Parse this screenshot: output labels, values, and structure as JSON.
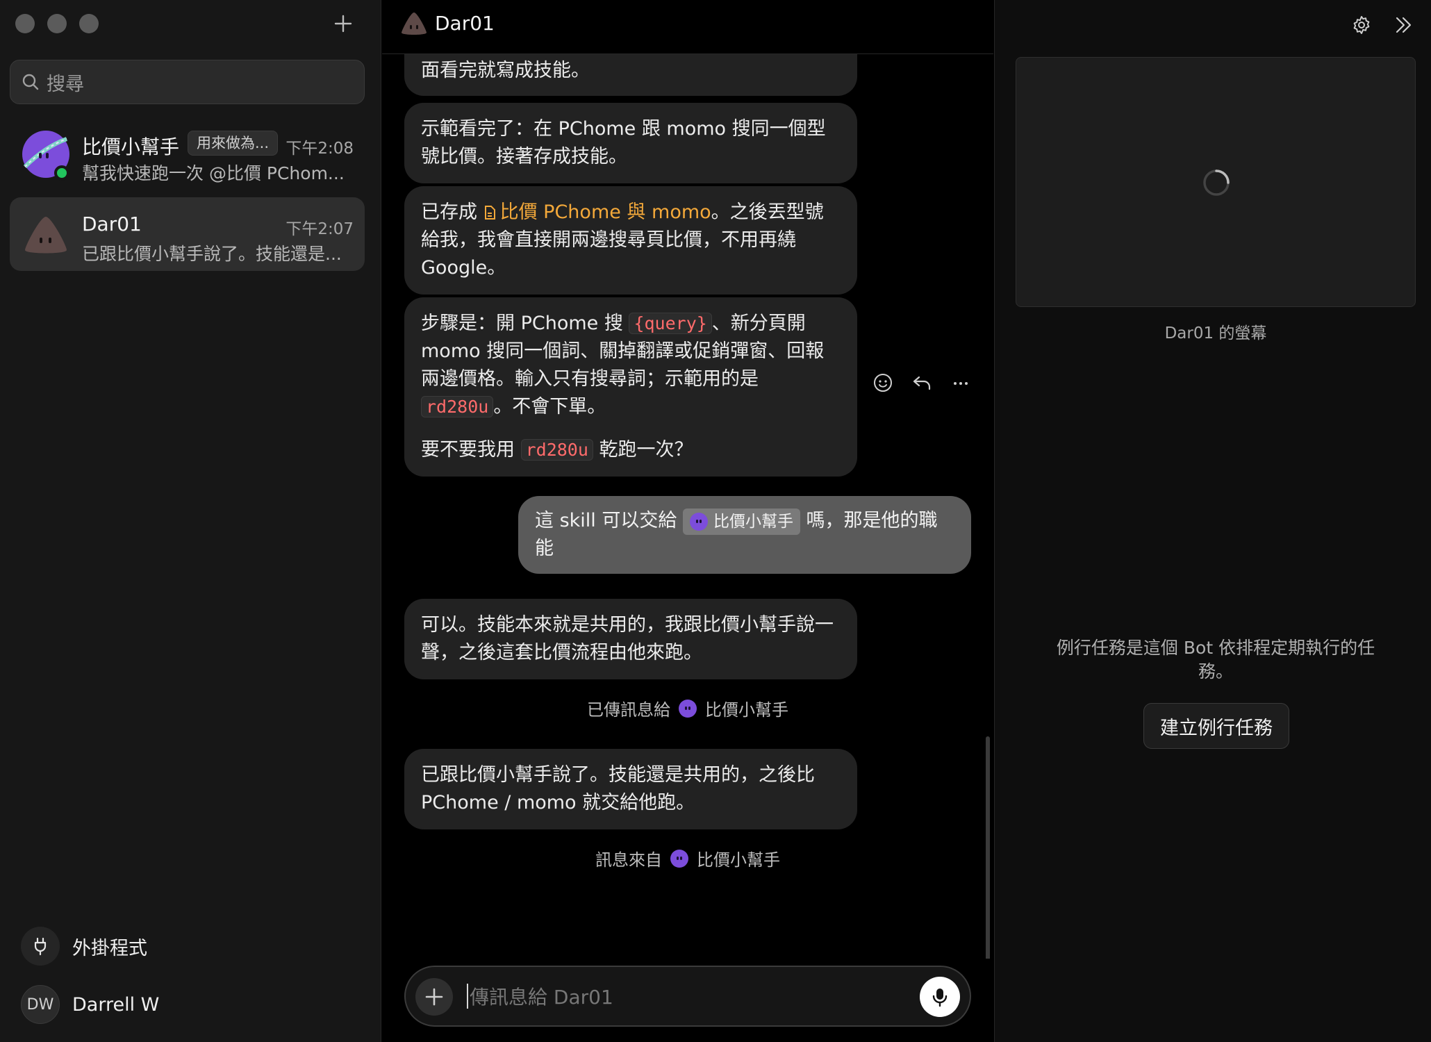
{
  "sidebar": {
    "search_placeholder": "搜尋",
    "conversations": [
      {
        "name": "比價小幫手",
        "badge": "用來做為...",
        "time": "下午2:08",
        "preview": "幫我快速跑一次 @比價 PChom..."
      },
      {
        "name": "Dar01",
        "time": "下午2:07",
        "preview": "已跟比價小幫手說了。技能還是..."
      }
    ],
    "plugins_label": "外掛程式",
    "user": {
      "initials": "DW",
      "name": "Darrell W"
    }
  },
  "chat": {
    "title": "Dar01",
    "messages": {
      "m1": "面看完就寫成技能。",
      "m2": "示範看完了：在 PChome 跟 momo 搜同一個型號比價。接著存成技能。",
      "m3_pre": "已存成 ",
      "m3_skill": "比價 PChome 與 momo",
      "m3_post": "。之後丟型號給我，我會直接開兩邊搜尋頁比價，不用再繞 Google。",
      "m4_a": "步驟是：開 PChome 搜 ",
      "m4_code1": "{query}",
      "m4_b": "、新分頁開 momo 搜同一個詞、關掉翻譯或促銷彈窗、回報兩邊價格。輸入只有搜尋詞；示範用的是 ",
      "m4_code2": "rd280u",
      "m4_c": "。不會下單。",
      "m4_q_a": "要不要我用 ",
      "m4_q_code": "rd280u",
      "m4_q_b": " 乾跑一次？",
      "user_a": "這 skill 可以交給 ",
      "user_mention": "比價小幫手",
      "user_b": " 嗎，那是他的職能",
      "m5": "可以。技能本來就是共用的，我跟比價小幫手說一聲，之後這套比價流程由他來跑。",
      "sys1_label": "已傳訊息給",
      "sys1_name": "比價小幫手",
      "m6": "已跟比價小幫手說了。技能還是共用的，之後比 PChome / momo 就交給他跑。",
      "sys2_label": "訊息來自",
      "sys2_name": "比價小幫手"
    },
    "composer_placeholder": "傳訊息給 Dar01"
  },
  "panel": {
    "screen_caption": "Dar01 的螢幕",
    "routine_description": "例行任務是這個 Bot 依排程定期執行的任務。",
    "routine_button": "建立例行任務"
  },
  "colors": {
    "skill_link": "#f4a93a",
    "code_text": "#ff6b6b",
    "online": "#22c55e",
    "bot_avatar": "#7c4ddb"
  },
  "icons": [
    "plus-icon",
    "search-icon",
    "plug-icon",
    "smile-icon",
    "reply-icon",
    "more-icon",
    "mic-icon",
    "gear-icon",
    "chevrons-right-icon",
    "spinner-icon",
    "skill-file-icon"
  ]
}
